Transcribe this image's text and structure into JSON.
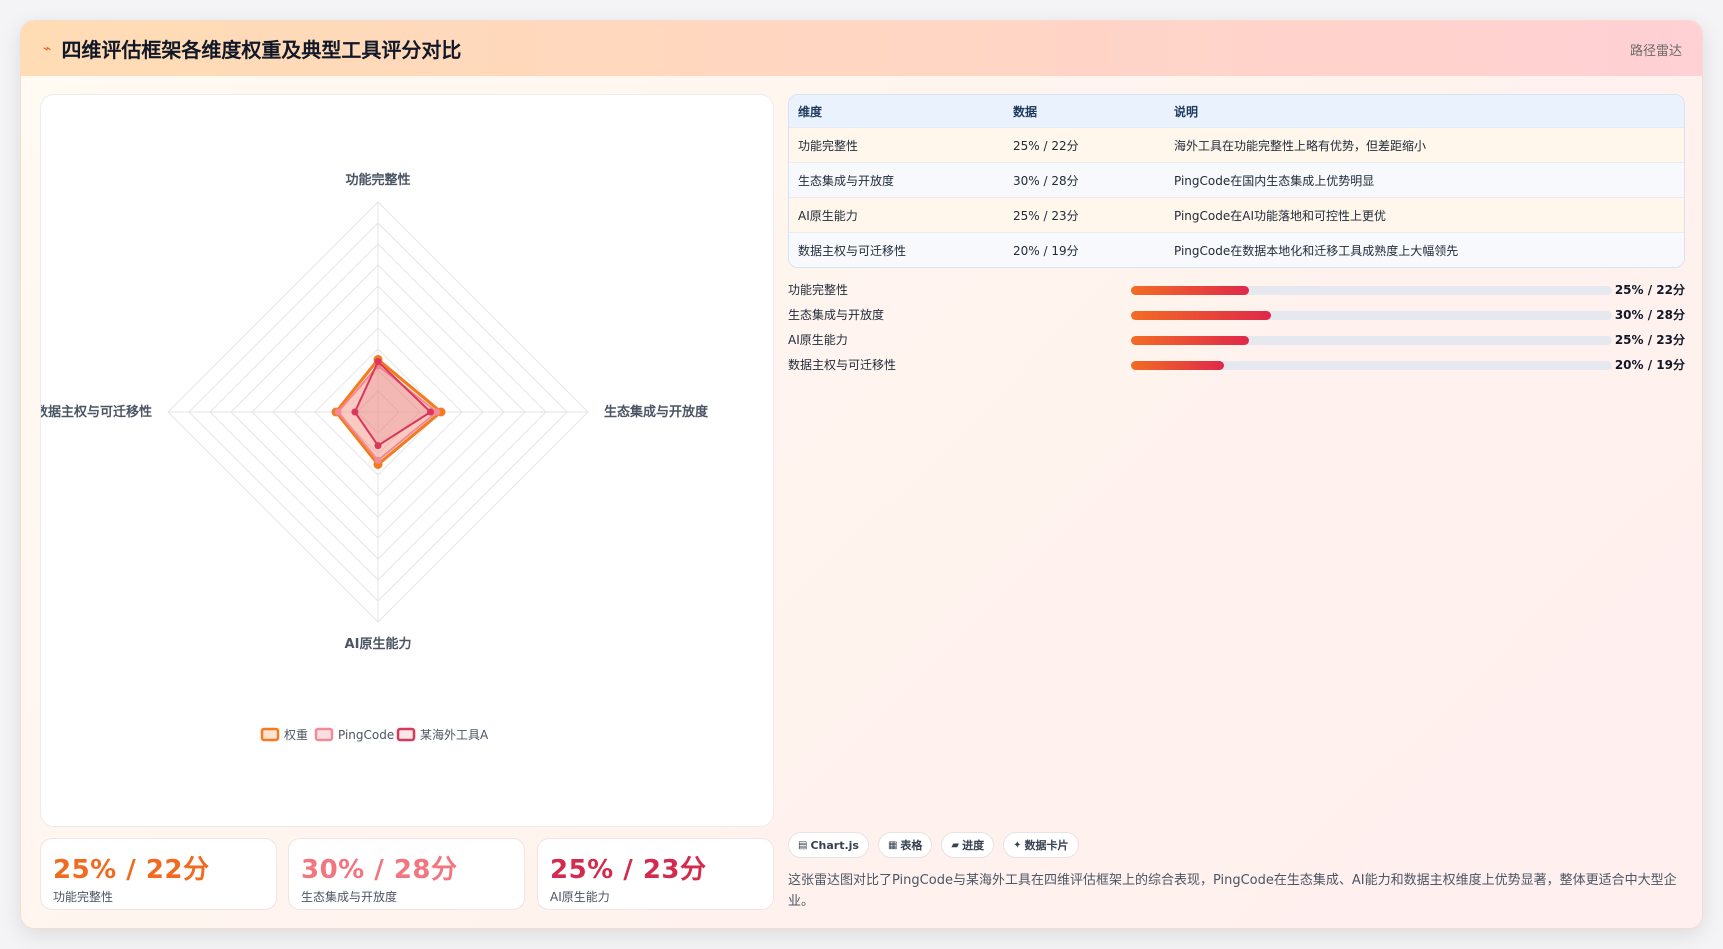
{
  "header": {
    "icon": "chart-line-icon",
    "title": "四维评估框架各维度权重及典型工具评分对比",
    "tag": "路径雷达"
  },
  "chart_data": {
    "type": "radar",
    "axes": [
      "功能完整性",
      "生态集成与开放度",
      "AI原生能力",
      "数据主权与可迁移性"
    ],
    "rmax": 100,
    "series": [
      {
        "name": "权重",
        "values": [
          25,
          30,
          25,
          20
        ],
        "color": "#f47a1f"
      },
      {
        "name": "PingCode",
        "values": [
          22,
          28,
          23,
          19
        ],
        "color": "#f28a98"
      },
      {
        "name": "某海外工具A",
        "values": [
          24,
          25,
          16,
          11
        ],
        "color": "#d9385a"
      }
    ]
  },
  "kpis": [
    {
      "value": "25% / 22分",
      "label": "功能完整性",
      "color": "#f06a1f"
    },
    {
      "value": "30% / 28分",
      "label": "生态集成与开放度",
      "color": "#f2757f"
    },
    {
      "value": "25% / 23分",
      "label": "AI原生能力",
      "color": "#d42a4e"
    }
  ],
  "table": {
    "headers": [
      "维度",
      "数据",
      "说明"
    ],
    "rows": [
      {
        "dim": "功能完整性",
        "data": "25% / 22分",
        "note": "海外工具在功能完整性上略有优势，但差距缩小"
      },
      {
        "dim": "生态集成与开放度",
        "data": "30% / 28分",
        "note": "PingCode在国内生态集成上优势明显"
      },
      {
        "dim": "AI原生能力",
        "data": "25% / 23分",
        "note": "PingCode在AI功能落地和可控性上更优"
      },
      {
        "dim": "数据主权与可迁移性",
        "data": "20% / 19分",
        "note": "PingCode在数据本地化和迁移工具成熟度上大幅领先"
      }
    ]
  },
  "bars": [
    {
      "label": "功能完整性",
      "value": "25% / 22分",
      "fraction": 0.245
    },
    {
      "label": "生态集成与开放度",
      "value": "30% / 28分",
      "fraction": 0.292
    },
    {
      "label": "AI原生能力",
      "value": "25% / 23分",
      "fraction": 0.245
    },
    {
      "label": "数据主权与可迁移性",
      "value": "20% / 19分",
      "fraction": 0.193
    }
  ],
  "chips": [
    {
      "icon": "chart-icon",
      "glyph": "▤",
      "label": "Chart.js"
    },
    {
      "icon": "table-icon",
      "glyph": "▦",
      "label": "表格"
    },
    {
      "icon": "progress-icon",
      "glyph": "▰",
      "label": "进度"
    },
    {
      "icon": "sparkle-icon",
      "glyph": "✦",
      "label": "数据卡片"
    }
  ],
  "description": "这张雷达图对比了PingCode与某海外工具在四维评估框架上的综合表现，PingCode在生态集成、AI能力和数据主权维度上优势显著，整体更适合中大型企业。"
}
